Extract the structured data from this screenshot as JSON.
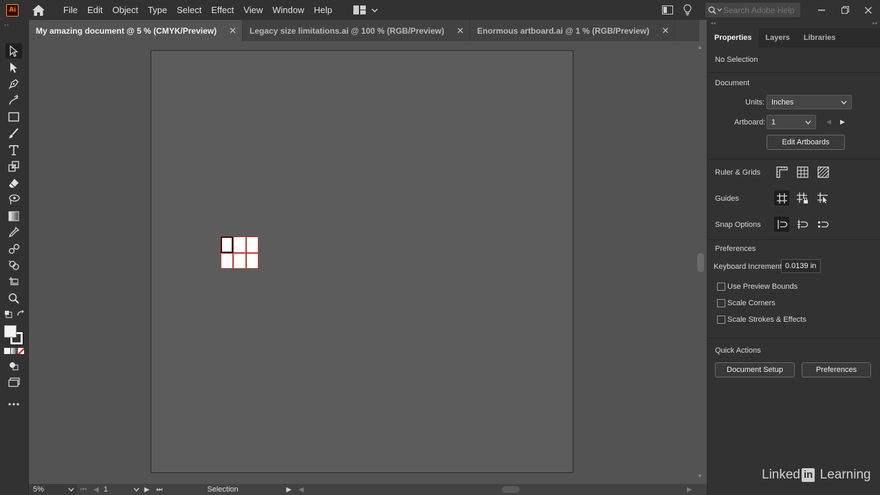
{
  "app": {
    "logo_text": "Ai",
    "accent_color": "#ff9a00"
  },
  "menubar": {
    "menus": [
      "File",
      "Edit",
      "Object",
      "Type",
      "Select",
      "Effect",
      "View",
      "Window",
      "Help"
    ],
    "search_placeholder": "Search Adobe Help"
  },
  "tabs": [
    {
      "label": "My amazing document @ 5 % (CMYK/Preview)",
      "active": true
    },
    {
      "label": "Legacy size limitations.ai @ 100 % (RGB/Preview)",
      "active": false
    },
    {
      "label": "Enormous artboard.ai @ 1 % (RGB/Preview)",
      "active": false
    }
  ],
  "tab_close_glyph": "✕",
  "statusbar": {
    "zoom": "5%",
    "artboard_number": "1",
    "status": "Selection"
  },
  "panel": {
    "tabs": [
      "Properties",
      "Layers",
      "Libraries"
    ],
    "selection_label": "No Selection",
    "document_header": "Document",
    "units_label": "Units:",
    "units_value": "Inches",
    "artboard_label": "Artboard:",
    "artboard_value": "1",
    "edit_artboards": "Edit Artboards",
    "ruler_grids": "Ruler & Grids",
    "guides": "Guides",
    "snap_options": "Snap Options",
    "preferences_header": "Preferences",
    "keyboard_increment_label": "Keyboard Increment:",
    "keyboard_increment_value": "0.0139 in",
    "checkboxes": [
      "Use Preview Bounds",
      "Scale Corners",
      "Scale Strokes & Effects"
    ],
    "quick_actions_header": "Quick Actions",
    "document_setup": "Document Setup",
    "preferences_button": "Preferences"
  },
  "watermark": {
    "part1": "Linked",
    "part2": "in",
    "part3": " Learning"
  }
}
